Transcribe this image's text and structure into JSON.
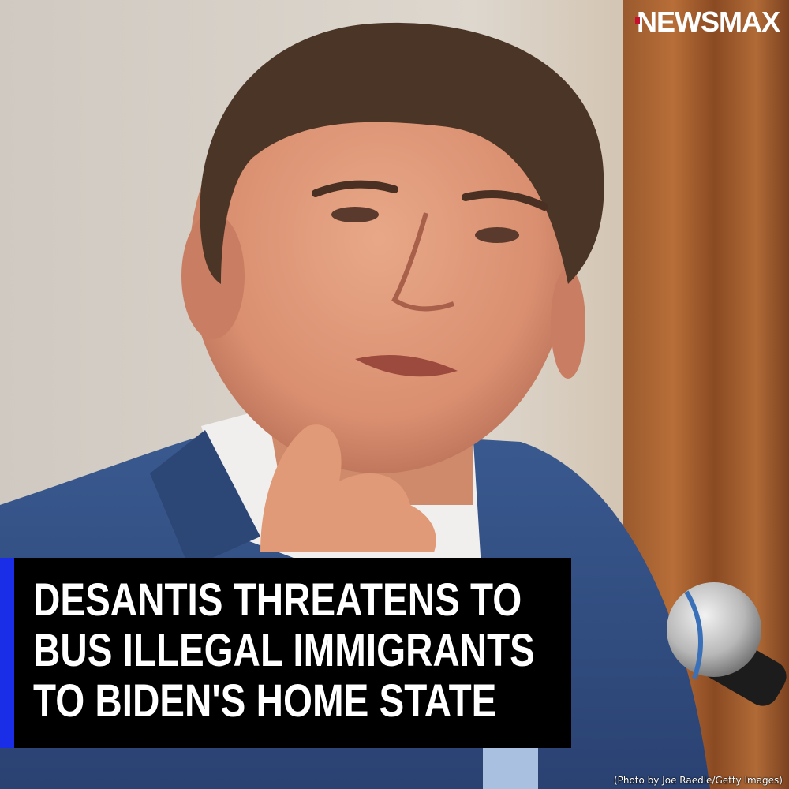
{
  "brand": {
    "logo_text": "NEWSMAX",
    "logo_color": "#ffffff",
    "logo_accent": "#c8102e"
  },
  "headline": {
    "lines": [
      "DESANTIS THREATENS TO",
      "BUS ILLEGAL IMMIGRANTS",
      "TO BIDEN'S HOME STATE"
    ],
    "box_color": "#000000",
    "bar_color": "#1a2ee8"
  },
  "photo": {
    "credit": "(Photo by Joe Raedle/Getty Images)"
  }
}
